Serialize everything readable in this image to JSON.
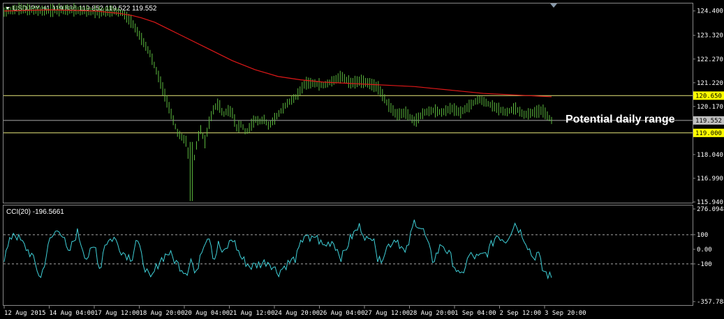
{
  "header": {
    "symbol_line": "USDJPY,H1  119.836 119.852 119.522 119.552",
    "menu_arrow_icon": "triangle-down-icon"
  },
  "indicator": {
    "label": "CCI(20) -196.5661"
  },
  "annotation": {
    "text": "Potential daily range"
  },
  "colors": {
    "background": "#000000",
    "candles": "#5dbb3f",
    "moving_average": "#e01818",
    "cci_line": "#3fd0d8",
    "level_line": "#e8e87a",
    "current_price_line": "#aaaaaa",
    "price_label_highlight": "#ffff00",
    "current_price_label_bg": "#c0c0c0"
  },
  "chart_data": [
    {
      "type": "line",
      "title": "USDJPY,H1",
      "price_axis_ticks": [
        "124.400",
        "123.320",
        "122.270",
        "121.220",
        "120.170",
        "118.040",
        "116.990",
        "115.940"
      ],
      "ylim": [
        115.94,
        124.7
      ],
      "x_ticks": [
        "12 Aug 2015",
        "14 Aug 04:00",
        "17 Aug 12:00",
        "18 Aug 20:00",
        "20 Aug 04:00",
        "21 Aug 12:00",
        "24 Aug 20:00",
        "26 Aug 04:00",
        "27 Aug 12:00",
        "28 Aug 20:00",
        "1 Sep 04:00",
        "2 Sep 12:00",
        "3 Sep 20:00"
      ],
      "price_series": {
        "name": "USDJPY",
        "x": [
          0,
          3,
          6,
          9,
          12,
          15,
          18,
          21,
          24,
          26,
          28,
          30,
          32,
          34,
          36,
          38,
          40,
          41,
          42,
          43,
          44,
          45,
          46,
          47,
          48,
          49,
          50,
          51,
          52,
          53,
          54,
          55,
          56,
          57,
          58,
          60,
          62,
          64,
          66,
          68,
          70,
          72,
          74,
          76,
          78,
          80,
          82,
          84,
          86,
          88,
          90,
          92,
          94,
          96,
          98,
          100,
          102,
          104,
          106,
          108,
          110,
          112,
          114,
          116,
          118,
          120
        ],
        "y": [
          124.35,
          124.5,
          124.45,
          124.4,
          124.45,
          124.45,
          124.4,
          124.35,
          124.4,
          124.3,
          123.9,
          123.2,
          122.5,
          121.4,
          120.2,
          119.0,
          118.6,
          117.0,
          118.3,
          119.2,
          118.6,
          119.5,
          120.1,
          120.3,
          119.8,
          120.0,
          119.9,
          119.2,
          119.4,
          119.0,
          119.3,
          119.6,
          119.5,
          119.6,
          119.3,
          119.8,
          120.3,
          120.6,
          121.2,
          121.2,
          121.1,
          121.3,
          121.5,
          121.2,
          121.3,
          121.2,
          121.0,
          120.3,
          119.8,
          119.9,
          119.5,
          119.9,
          120.0,
          119.9,
          120.1,
          119.9,
          120.2,
          120.5,
          120.3,
          120.1,
          119.9,
          120.1,
          119.8,
          119.9,
          120.0,
          119.55
        ]
      },
      "moving_average": {
        "x": [
          0,
          10,
          20,
          25,
          28,
          30,
          33,
          36,
          40,
          45,
          50,
          55,
          60,
          65,
          70,
          75,
          80,
          85,
          90,
          95,
          100,
          105,
          110,
          115,
          120
        ],
        "y": [
          124.4,
          124.45,
          124.4,
          124.3,
          124.2,
          124.1,
          123.9,
          123.6,
          123.2,
          122.7,
          122.2,
          121.8,
          121.5,
          121.35,
          121.25,
          121.2,
          121.15,
          121.1,
          121.05,
          120.95,
          120.85,
          120.75,
          120.7,
          120.65,
          120.6
        ]
      },
      "horizontal_levels": [
        {
          "label": "120.650",
          "value": 120.65
        },
        {
          "label": "119.552",
          "value": 119.552
        },
        {
          "label": "119.000",
          "value": 119.0
        }
      ]
    },
    {
      "type": "line",
      "title": "CCI(20)",
      "axis_ticks": [
        "276.0948",
        "100",
        "0.00",
        "-100",
        "-357.7888"
      ],
      "ylim": [
        -357.7888,
        276.0948
      ],
      "dashed_levels": [
        100,
        -100
      ],
      "series": {
        "x": [
          0,
          2,
          4,
          6,
          8,
          10,
          12,
          13,
          14,
          16,
          18,
          20,
          21,
          22,
          24,
          26,
          28,
          29,
          30,
          32,
          34,
          36,
          38,
          40,
          41,
          42,
          43,
          44,
          45,
          46,
          47,
          48,
          50,
          52,
          54,
          56,
          58,
          60,
          62,
          64,
          66,
          67,
          68,
          70,
          72,
          74,
          76,
          78,
          80,
          81,
          82,
          84,
          86,
          88,
          90,
          92,
          94,
          96,
          98,
          100,
          101,
          102,
          104,
          106,
          108,
          110,
          112,
          114,
          116,
          117,
          118,
          120
        ],
        "y": [
          -60,
          120,
          40,
          -40,
          -200,
          60,
          150,
          80,
          -40,
          120,
          -60,
          20,
          -150,
          40,
          80,
          -20,
          -60,
          80,
          -40,
          -220,
          -80,
          -20,
          -100,
          -160,
          -60,
          -200,
          -20,
          60,
          100,
          -80,
          40,
          -40,
          80,
          -60,
          -120,
          -100,
          -80,
          -160,
          -100,
          -60,
          120,
          40,
          100,
          20,
          60,
          -60,
          80,
          160,
          40,
          120,
          -100,
          20,
          80,
          -40,
          200,
          120,
          -80,
          40,
          -60,
          -200,
          -120,
          -40,
          -60,
          -20,
          100,
          60,
          180,
          80,
          -60,
          -20,
          -140,
          -196.5661
        ]
      }
    }
  ]
}
